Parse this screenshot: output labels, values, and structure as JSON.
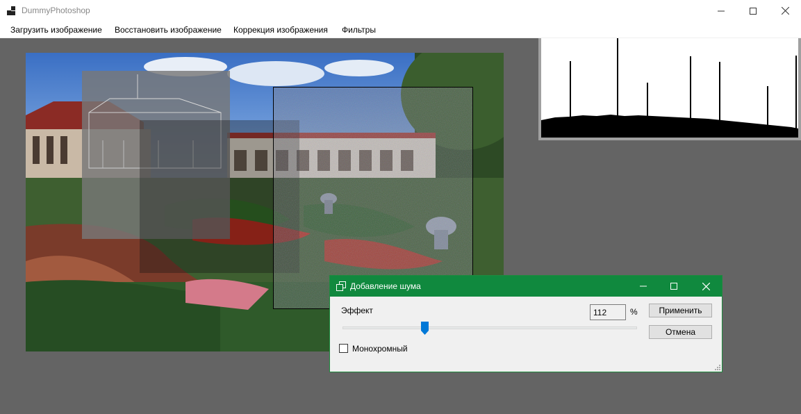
{
  "window": {
    "title": "DummyPhotoshop"
  },
  "menu": {
    "items": [
      {
        "label": "Загрузить изображение"
      },
      {
        "label": "Восстановить изображение"
      },
      {
        "label": "Коррекция изображения"
      },
      {
        "label": "Фильтры"
      }
    ]
  },
  "dialog": {
    "title": "Добавление шума",
    "effect_label": "Эффект",
    "effect_value": "112",
    "percent_label": "%",
    "apply_label": "Применить",
    "cancel_label": "Отмена",
    "mono_label": "Монохромный",
    "mono_checked": false,
    "slider_fraction": 0.28
  },
  "colors": {
    "dialog_title_bg": "#10893e",
    "workspace_bg": "#646464",
    "slider_thumb": "#0078d7"
  },
  "icons": [
    "app-icon",
    "minimize-icon",
    "maximize-icon",
    "close-icon",
    "dialog-icon",
    "checkbox-icon",
    "resize-grip-icon"
  ]
}
